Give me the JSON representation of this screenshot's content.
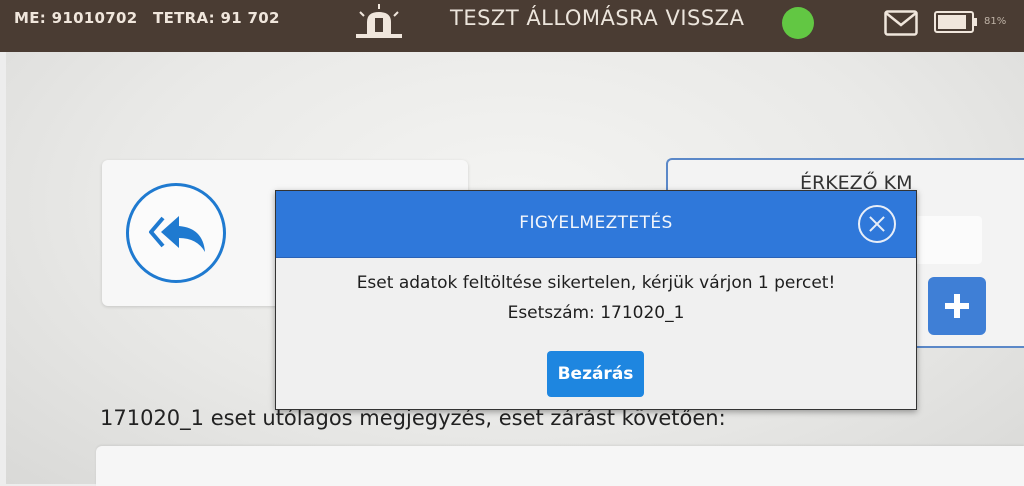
{
  "status_bar": {
    "me_id": "ME: 91010702",
    "tetra_id": "TETRA: 91 702",
    "status_text": "TESZT ÁLLOMÁSRA VISSZA",
    "battery_percent": "81%",
    "status_color": "#62c743"
  },
  "background": {
    "arrival_km_label": "ÉRKEZŐ KM",
    "note_label": "171020_1 eset utólagos megjegyzés, eset zárást követően:"
  },
  "dialog": {
    "title": "FIGYELMEZTETÉS",
    "message": "Eset adatok feltöltése sikertelen, kérjük várjon 1 percet!",
    "case_number": "Esetszám: 171020_1",
    "close_button_label": "Bezárás"
  },
  "icons": {
    "siren": "siren-icon",
    "status": "status-indicator-icon",
    "mail": "mail-icon",
    "battery": "battery-icon",
    "back": "reply-all-icon",
    "plus": "plus-icon",
    "close": "close-icon"
  },
  "colors": {
    "accent_blue": "#2f78da",
    "button_blue": "#1e86e0",
    "topbar": "#4a3c33"
  }
}
